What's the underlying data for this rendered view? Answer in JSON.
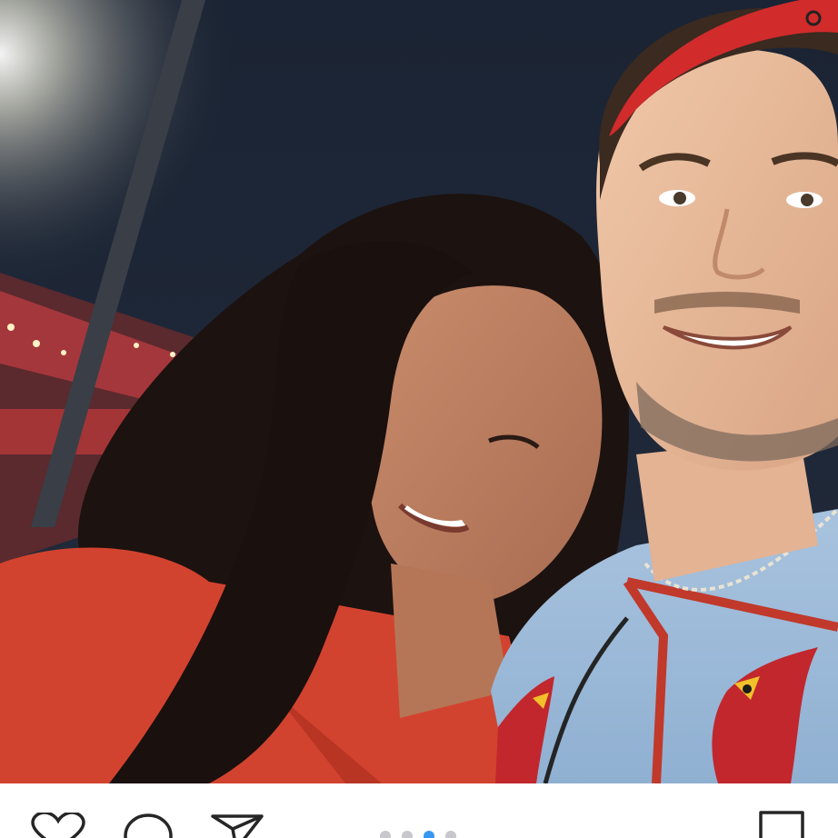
{
  "post": {
    "photo": {
      "description_icon": "photo-carousel-slide"
    },
    "actions": {
      "like_icon": "heart-outline-icon",
      "comment_icon": "comment-bubble-icon",
      "share_icon": "paper-plane-icon",
      "save_icon": "bookmark-outline-icon"
    },
    "carousel": {
      "total_slides": 4,
      "active_slide": 3,
      "active_color": "#3897f0",
      "inactive_color": "#c7c7cc"
    }
  }
}
